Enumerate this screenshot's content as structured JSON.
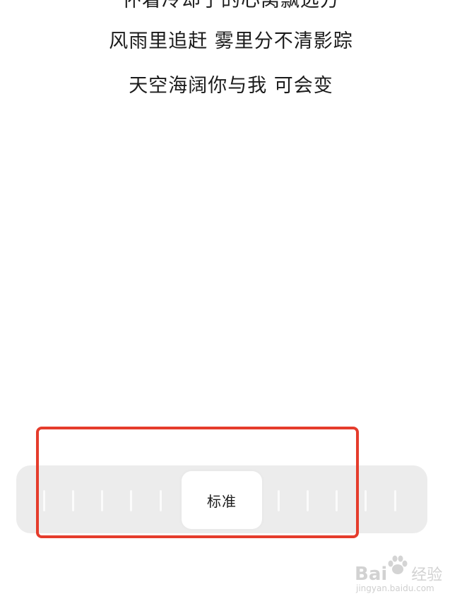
{
  "lyrics": [
    "怀着冷却了的心窝飘远方",
    "风雨里追赶 雾里分不清影踪",
    "天空海阔你与我 可会变"
  ],
  "speed_slider": {
    "selected_label": "标准",
    "tick_count_left": 5,
    "tick_count_right": 5
  },
  "watermark": {
    "brand": "Bai",
    "brand_suffix": "经验",
    "url": "jingyan.baidu.com"
  },
  "colors": {
    "highlight_border": "#e53c2c",
    "track_background": "#ececec",
    "thumb_background": "#ffffff"
  }
}
